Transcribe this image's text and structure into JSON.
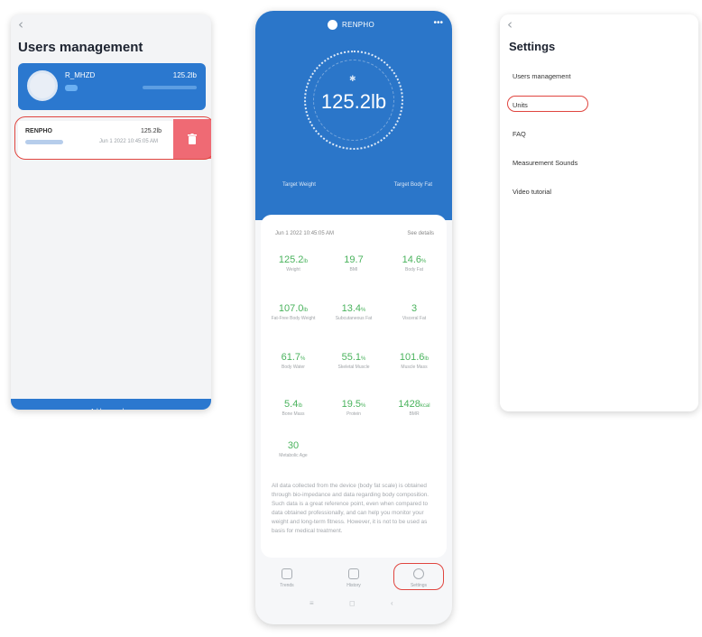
{
  "users_screen": {
    "back_icon": "‹",
    "title": "Users management",
    "main_user": {
      "name": "R_MHZD",
      "weight": "125.2lb"
    },
    "sub_user": {
      "name": "RENPHO",
      "weight": "125.2lb",
      "date": "Jun 1 2022 10:45:05 AM",
      "delete_icon": "trash-icon"
    },
    "add_button": "Add a member"
  },
  "main_screen": {
    "brand": "RENPHO",
    "more_icon": "•••",
    "weight_display": "125.2lb",
    "bluetooth_icon": "✱",
    "target_weight_label": "Target Weight",
    "target_body_fat_label": "Target Body Fat",
    "date": "Jun 1 2022 10:45:05 AM",
    "see_all": "See details",
    "metrics": [
      {
        "value": "125.2",
        "unit": "lb",
        "label": "Weight"
      },
      {
        "value": "19.7",
        "unit": "",
        "label": "BMI"
      },
      {
        "value": "14.6",
        "unit": "%",
        "label": "Body Fat"
      },
      {
        "value": "107.0",
        "unit": "lb",
        "label": "Fat-Free Body Weight"
      },
      {
        "value": "13.4",
        "unit": "%",
        "label": "Subcutaneous Fat"
      },
      {
        "value": "3",
        "unit": "",
        "label": "Visceral Fat"
      },
      {
        "value": "61.7",
        "unit": "%",
        "label": "Body Water"
      },
      {
        "value": "55.1",
        "unit": "%",
        "label": "Skeletal Muscle"
      },
      {
        "value": "101.6",
        "unit": "lb",
        "label": "Muscle Mass"
      },
      {
        "value": "5.4",
        "unit": "lb",
        "label": "Bone Mass"
      },
      {
        "value": "19.5",
        "unit": "%",
        "label": "Protein"
      },
      {
        "value": "1428",
        "unit": "kcal",
        "label": "BMR"
      },
      {
        "value": "30",
        "unit": "",
        "label": "Metabolic Age"
      }
    ],
    "note": "All data collected from the device (body fat scale) is obtained through bio-impedance and data regarding body composition. Such data is a great reference point, even when compared to data obtained professionally, and can help you monitor your weight and long-term fitness. However, it is not to be used as basis for medical treatment.",
    "tabs": [
      {
        "label": "Trends",
        "icon": "trends-icon"
      },
      {
        "label": "History",
        "icon": "history-icon"
      },
      {
        "label": "Settings",
        "icon": "settings-icon"
      }
    ],
    "nav_glyphs": [
      "≡",
      "◻",
      "‹"
    ]
  },
  "settings_screen": {
    "back_icon": "‹",
    "title": "Settings",
    "items": [
      "Users management",
      "Units",
      "FAQ",
      "Measurement Sounds",
      "Video tutorial"
    ]
  },
  "colors": {
    "primary": "#2b78cf",
    "metric_green": "#4ab35d",
    "highlight": "#e0453f",
    "delete": "#ef6a74"
  }
}
